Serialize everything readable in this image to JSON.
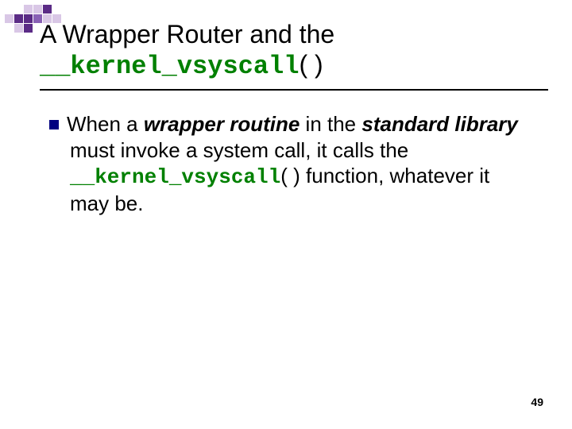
{
  "title": {
    "line1": "A Wrapper Router and the ",
    "code": "__kernel_vsyscall",
    "after_code": "( )"
  },
  "bullet": {
    "segments": [
      {
        "text": "When a ",
        "style": "plain"
      },
      {
        "text": "wrapper routine",
        "style": "bi"
      },
      {
        "text": " in the ",
        "style": "plain"
      },
      {
        "text": "standard library",
        "style": "bi"
      },
      {
        "text": " must invoke a system call, it calls the ",
        "style": "plain"
      },
      {
        "text": "__kernel_vsyscall",
        "style": "bcode"
      },
      {
        "text": "( ) function, whatever it may be.",
        "style": "plain"
      }
    ]
  },
  "page_number": "49"
}
